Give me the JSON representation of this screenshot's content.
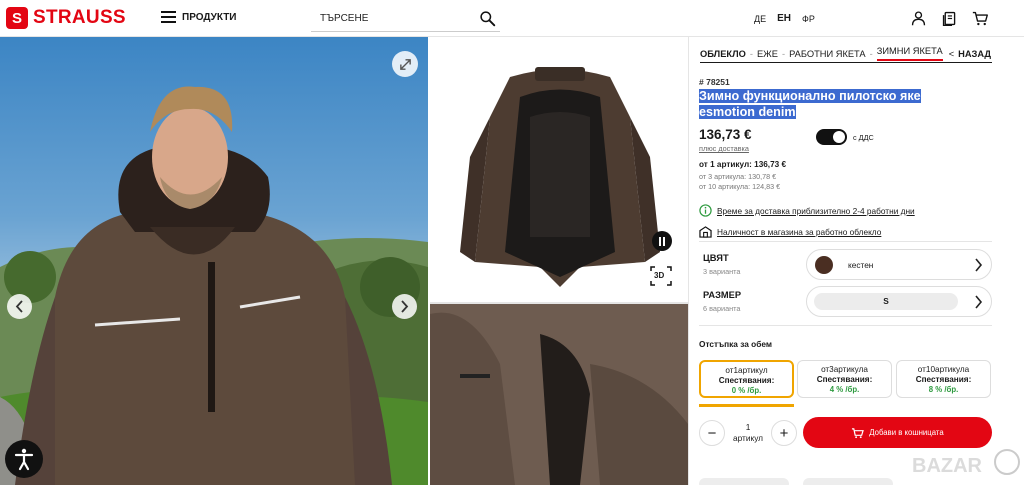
{
  "header": {
    "logo_text": "STRAUSS",
    "logo_mark": "S",
    "menu_label": "ПРОДУКТИ",
    "search_placeholder": "ТЪРСЕНЕ",
    "languages": [
      {
        "label": "ДЕ",
        "active": false
      },
      {
        "label": "ЕН",
        "active": true
      },
      {
        "label": "ФР",
        "active": false
      }
    ],
    "icons": [
      "user-icon",
      "wishlist-icon",
      "cart-icon"
    ]
  },
  "gallery": {
    "badge_3d": "3D",
    "icons": [
      "expand-icon",
      "chevron-left-icon",
      "chevron-right-icon",
      "pause-icon",
      "accessibility-icon"
    ]
  },
  "breadcrumb": {
    "items": [
      "ОБЛЕКЛО",
      "ЕЖЕ",
      "РАБОТНИ ЯКЕТА",
      "ЗИМНИ ЯКЕТА"
    ],
    "back_label": "НАЗАД"
  },
  "product": {
    "sku": "# 78251",
    "title_line1": "Зимно функционално пилотско яке",
    "title_line2": "esmotion denim",
    "price": "136,73 €",
    "shipping_link": "плюс доставка",
    "vat_toggle_on": true,
    "vat_label": "с ДДС",
    "tier_main": "от 1 артикул: 136,73 €",
    "tier_3": "от 3 артикула: 130,78 €",
    "tier_10": "от 10 артикула: 124,83 €",
    "delivery_info": "Време за доставка приблизително 2-4 работни дни",
    "store_info": "Наличност в магазина за работно облекло"
  },
  "selectors": {
    "color_label": "ЦВЯТ",
    "color_variants": "3 варианта",
    "color_value": "кестен",
    "color_swatch": "#4a2e22",
    "size_label": "РАЗМЕР",
    "size_variants": "6 варианта",
    "size_value": "S"
  },
  "volume": {
    "title": "Отстъпка за обем",
    "cards": [
      {
        "l1": "от1артикул",
        "l2": "Спестявания:",
        "l3": "0 % /бр.",
        "selected": true
      },
      {
        "l1": "от3артикула",
        "l2": "Спестявания:",
        "l3": "4 % /бр.",
        "selected": false
      },
      {
        "l1": "от10артикула",
        "l2": "Спестявания:",
        "l3": "8 % /бр.",
        "selected": false
      }
    ]
  },
  "cart": {
    "qty_value": "1",
    "qty_unit": "артикул",
    "minus": "−",
    "plus": "+",
    "add_label": "Добави в кошницата"
  },
  "colors": {
    "brand_red": "#e30613",
    "highlight_blue": "#3c6ad0",
    "savings_green": "#2e9a3f",
    "selected_orange": "#f0a500"
  }
}
